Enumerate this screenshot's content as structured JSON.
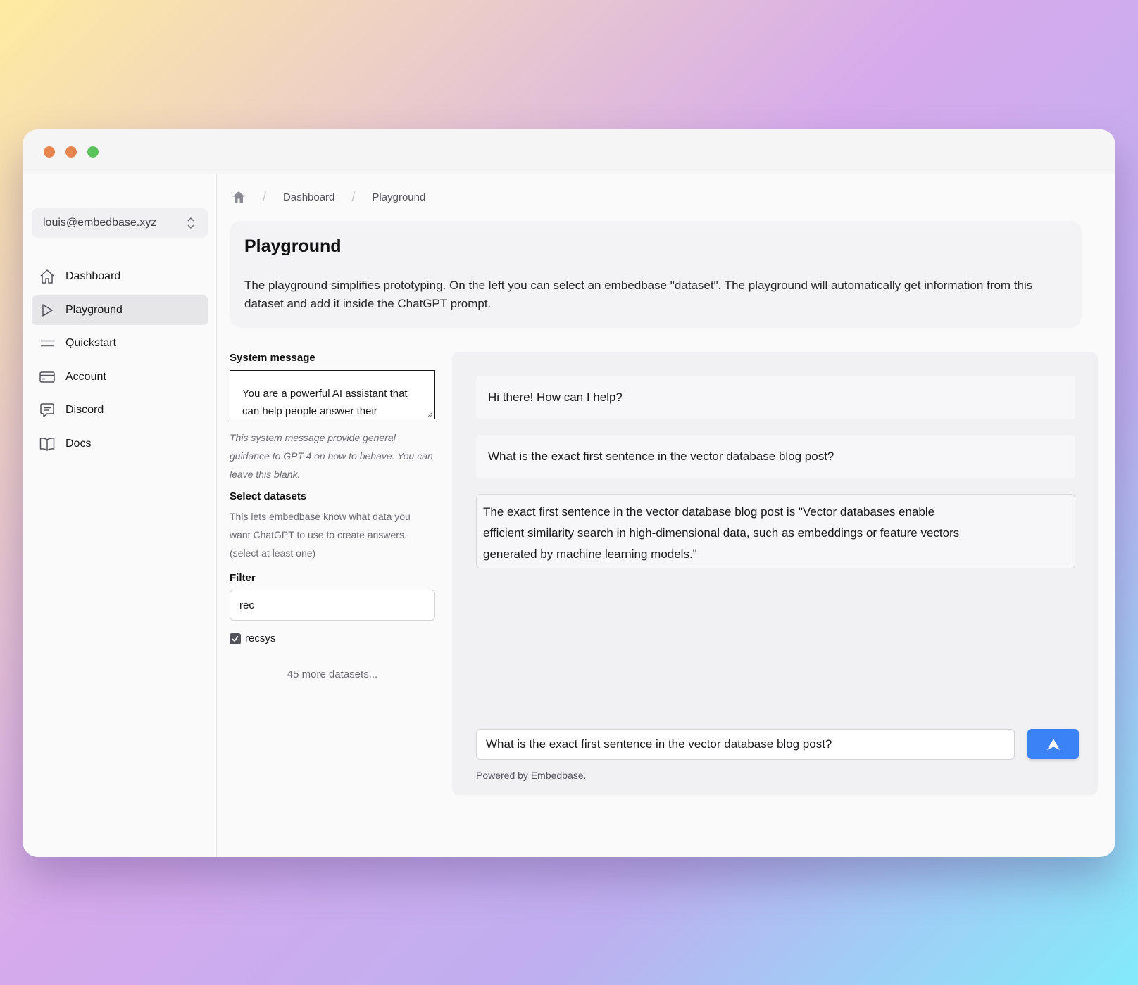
{
  "window": {
    "controls": [
      "close",
      "minimize",
      "zoom"
    ],
    "colors": {
      "close": "#e8844e",
      "minimize": "#e8844e",
      "zoom": "#5bc25a"
    }
  },
  "sidebar": {
    "account": "louis@embedbase.xyz",
    "items": [
      {
        "label": "Dashboard",
        "icon": "home-icon",
        "active": false
      },
      {
        "label": "Playground",
        "icon": "play-icon",
        "active": true
      },
      {
        "label": "Quickstart",
        "icon": "lines-icon",
        "active": false
      },
      {
        "label": "Account",
        "icon": "credit-card-icon",
        "active": false
      },
      {
        "label": "Discord",
        "icon": "chat-bubble-icon",
        "active": false
      },
      {
        "label": "Docs",
        "icon": "book-icon",
        "active": false
      }
    ]
  },
  "breadcrumb": {
    "home_icon": "home-icon",
    "items": [
      "Dashboard",
      "Playground"
    ]
  },
  "intro": {
    "title": "Playground",
    "description": "The playground simplifies prototyping. On the left you can select an embedbase \"dataset\". The playground will automatically get information from this dataset and add it inside the ChatGPT prompt."
  },
  "settings": {
    "system_label": "System message",
    "system_value": "You are a powerful AI assistant that can help people answer their",
    "system_hint": "This system message provide general guidance to GPT-4 on how to behave. You can leave this blank.",
    "datasets_label": "Select datasets",
    "datasets_hint": "This lets embedbase know what data you want ChatGPT to use to create answers. (select at least one)",
    "filter_label": "Filter",
    "filter_value": "rec",
    "dataset_option": "recsys",
    "dataset_checked": true,
    "more_datasets": "45 more datasets..."
  },
  "chat": {
    "messages": [
      {
        "role": "assistant",
        "text": "Hi there! How can I help?"
      },
      {
        "role": "user",
        "text": "What is the exact first sentence in the vector database blog post?"
      },
      {
        "role": "assistant",
        "lines": [
          "The exact first sentence in the vector database blog post is \"Vector databases enable",
          "efficient similarity search in high-dimensional data, such as embeddings or feature vectors",
          "generated by machine learning models.\""
        ]
      }
    ],
    "input_value": "What is the exact first sentence in the vector database blog post?",
    "send_icon": "send-arrow-icon",
    "accent": "#3b82f6",
    "footer": "Powered by Embedbase."
  }
}
